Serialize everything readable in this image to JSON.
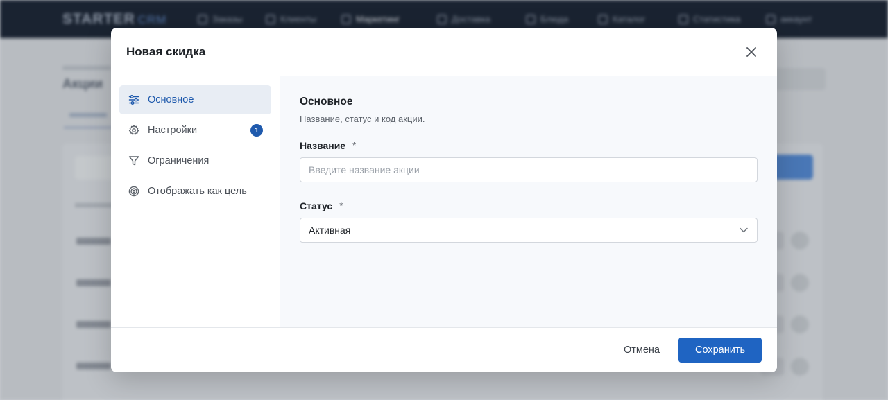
{
  "background": {
    "logo": "STARTER",
    "logo_suffix": "CRM",
    "nav": [
      "Заказы",
      "Клиенты",
      "Маркетинг",
      "Доставка",
      "Блюда",
      "Каталог",
      "Статистика",
      "аккаунт"
    ],
    "page_title": "Акции"
  },
  "modal": {
    "title": "Новая скидка",
    "sidebar": [
      {
        "label": "Основное",
        "icon": "sliders-icon",
        "active": true
      },
      {
        "label": "Настройки",
        "icon": "gear-icon",
        "badge": "1"
      },
      {
        "label": "Ограничения",
        "icon": "filter-icon"
      },
      {
        "label": "Отображать как цель",
        "icon": "target-icon"
      }
    ],
    "section": {
      "title": "Основное",
      "description": "Название, статус и код акции."
    },
    "fields": {
      "name_label": "Название",
      "name_required": "*",
      "name_placeholder": "Введите название акции",
      "status_label": "Статус",
      "status_required": "*",
      "status_value": "Активная"
    },
    "footer": {
      "cancel": "Отмена",
      "save": "Сохранить"
    }
  },
  "colors": {
    "accent": "#1f64c2",
    "active_bg": "#e8edf4",
    "badge": "#1f5aad"
  }
}
